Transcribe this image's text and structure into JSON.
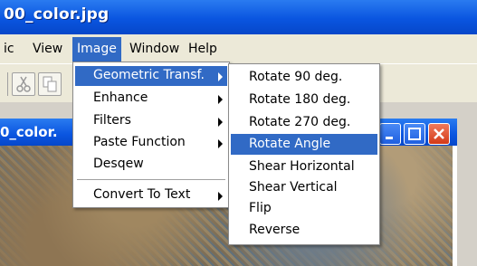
{
  "app": {
    "title": "00_color.jpg"
  },
  "menubar": {
    "items": [
      {
        "label": "ic"
      },
      {
        "label": "View"
      },
      {
        "label": "Image"
      },
      {
        "label": "Window"
      },
      {
        "label": "Help"
      }
    ]
  },
  "image_menu": {
    "items": [
      {
        "label": "Geometric Transf."
      },
      {
        "label": "Enhance"
      },
      {
        "label": "Filters"
      },
      {
        "label": "Paste Function"
      },
      {
        "label": "Desqew"
      },
      {
        "label": "Convert To Text"
      }
    ]
  },
  "geometric_submenu": {
    "items": [
      {
        "label": "Rotate  90 deg."
      },
      {
        "label": "Rotate 180 deg."
      },
      {
        "label": "Rotate 270 deg."
      },
      {
        "label": "Rotate Angle"
      },
      {
        "label": "Shear Horizontal"
      },
      {
        "label": "Shear Vertical"
      },
      {
        "label": "Flip"
      },
      {
        "label": "Reverse"
      }
    ]
  },
  "child_window": {
    "title": "0_color."
  },
  "icons": {
    "cut": "scissors-icon",
    "copy": "copy-icon",
    "minimize": "minimize-icon",
    "maximize": "maximize-icon",
    "close": "close-icon"
  },
  "colors": {
    "titlebar": "#0a55e0",
    "highlight": "#316ac5",
    "close_button": "#e0452a"
  }
}
